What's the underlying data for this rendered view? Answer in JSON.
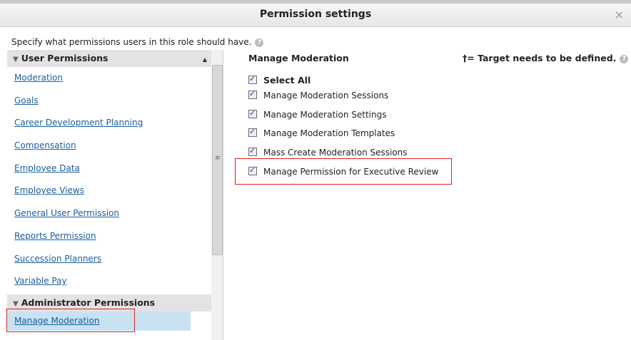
{
  "dialog": {
    "title": "Permission settings",
    "close_symbol": "×"
  },
  "intro": {
    "text": "Specify what permissions users in this role should have."
  },
  "left": {
    "user_section": "User Permissions",
    "user_items": [
      "Moderation",
      "Goals",
      "Career Development Planning",
      "Compensation",
      "Employee Data",
      "Employee Views",
      "General User Permission",
      "Reports Permission",
      "Succession Planners",
      "Variable Pay"
    ],
    "admin_section": "Administrator Permissions",
    "admin_items": [
      "Manage Moderation"
    ]
  },
  "right": {
    "title": "Manage Moderation",
    "note": "†= Target needs to be defined.",
    "select_all": "Select All",
    "permissions": [
      "Manage Moderation Sessions",
      "Manage Moderation Settings",
      "Manage Moderation Templates",
      "Mass Create Moderation Sessions",
      "Manage Permission for Executive Review"
    ]
  },
  "icons": [
    "close-icon",
    "help-icon",
    "collapse-triangle-icon",
    "scroll-up-icon",
    "scroll-grip-icon"
  ],
  "colors": {
    "link": "#1b5e9e",
    "selected_bg": "#c9e2f2",
    "highlight_box": "#e02020"
  }
}
